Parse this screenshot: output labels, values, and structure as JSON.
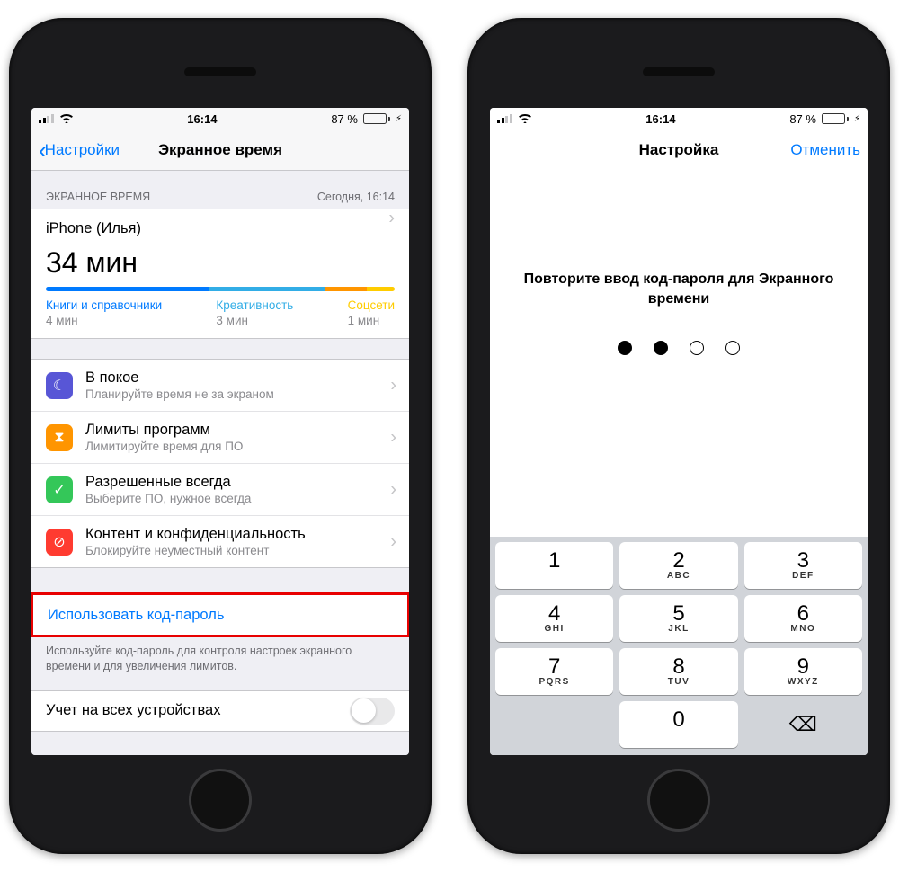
{
  "status": {
    "time": "16:14",
    "battery_pct": "87 %"
  },
  "left": {
    "back_label": "Настройки",
    "title": "Экранное время",
    "section_left": "ЭКРАННОЕ ВРЕМЯ",
    "section_right": "Сегодня, 16:14",
    "device_label": "iPhone (Илья)",
    "total_time": "34 мин",
    "categories": [
      {
        "name": "Книги и справочники",
        "value": "4 мин",
        "color": "#007aff",
        "width": 47
      },
      {
        "name": "Креативность",
        "value": "3 мин",
        "color": "#32ade6",
        "width": 33
      },
      {
        "name": "",
        "value": "",
        "color": "#ff9500",
        "width": 12
      },
      {
        "name": "Соцсети",
        "value": "1 мин",
        "color": "#ffcc00",
        "width": 8
      }
    ],
    "items": [
      {
        "title": "В покое",
        "sub": "Планируйте время не за экраном",
        "color": "#5856d6",
        "glyph": "☾"
      },
      {
        "title": "Лимиты программ",
        "sub": "Лимитируйте время для ПО",
        "color": "#ff9500",
        "glyph": "⧗"
      },
      {
        "title": "Разрешенные всегда",
        "sub": "Выберите ПО, нужное всегда",
        "color": "#34c759",
        "glyph": "✓"
      },
      {
        "title": "Контент и конфиденциальность",
        "sub": "Блокируйте неуместный контент",
        "color": "#ff3b30",
        "glyph": "⊘"
      }
    ],
    "passcode_link": "Использовать код-пароль",
    "passcode_note": "Используйте код-пароль для контроля настроек экранного времени и для увеличения лимитов.",
    "share_label": "Учет на всех устройствах"
  },
  "right": {
    "title": "Настройка",
    "cancel": "Отменить",
    "prompt": "Повторите ввод код-пароля для Экранного времени",
    "dots_filled": 2,
    "keys": [
      {
        "n": "1",
        "l": ""
      },
      {
        "n": "2",
        "l": "ABC"
      },
      {
        "n": "3",
        "l": "DEF"
      },
      {
        "n": "4",
        "l": "GHI"
      },
      {
        "n": "5",
        "l": "JKL"
      },
      {
        "n": "6",
        "l": "MNO"
      },
      {
        "n": "7",
        "l": "PQRS"
      },
      {
        "n": "8",
        "l": "TUV"
      },
      {
        "n": "9",
        "l": "WXYZ"
      }
    ],
    "zero": "0"
  }
}
